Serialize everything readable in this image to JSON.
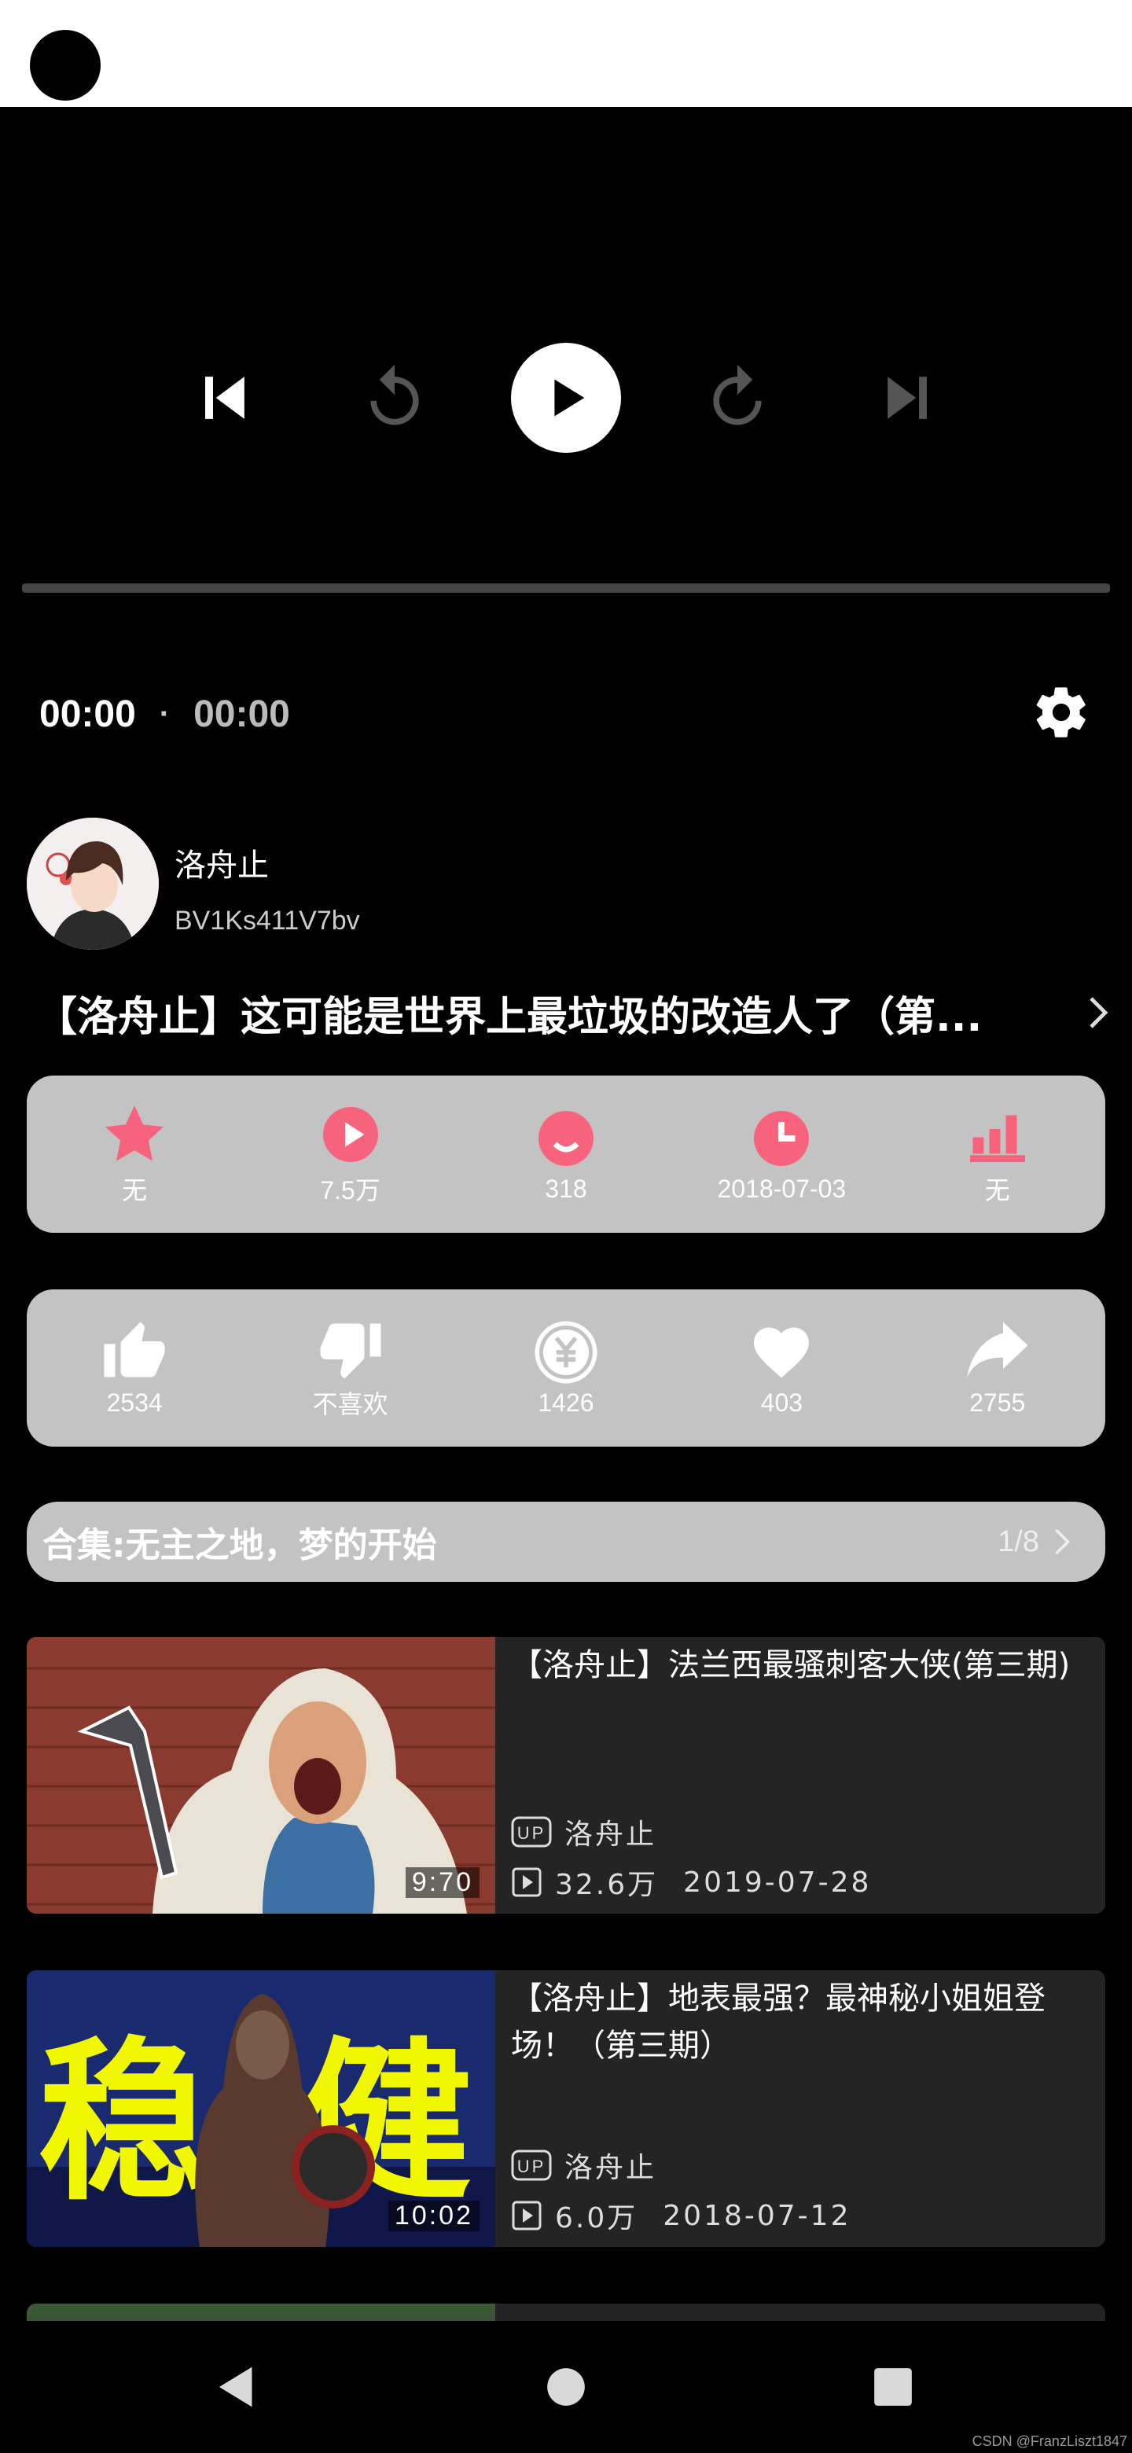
{
  "player": {
    "current_time": "00:00",
    "separator": "·",
    "total_time": "00:00"
  },
  "uploader": {
    "name": "洛舟止",
    "bvid": "BV1Ks411V7bv"
  },
  "video": {
    "title": "【洛舟止】这可能是世界上最垃圾的改造人了（第..."
  },
  "stats": {
    "favorite": "无",
    "plays": "7.5万",
    "danmaku": "318",
    "date": "2018-07-03",
    "rank": "无"
  },
  "actions": {
    "like": "2534",
    "dislike": "不喜欢",
    "coin": "1426",
    "favorite": "403",
    "share": "2755"
  },
  "colors": {
    "accent": "#f7637c",
    "card_bg": "#c3c3c3",
    "item_bg": "#242424"
  },
  "collection": {
    "title": "合集:无主之地，梦的开始",
    "count": "1/8"
  },
  "videos": [
    {
      "title": "【洛舟止】法兰西最骚刺客大侠(第三期)",
      "duration": "9:70",
      "up_badge": "UP",
      "uploader": "洛舟止",
      "views": "32.6万",
      "date": "2019-07-28"
    },
    {
      "title": "【洛舟止】地表最强？最神秘小姐姐登场！（第三期）",
      "duration": "10:02",
      "up_badge": "UP",
      "uploader": "洛舟止",
      "views": "6.0万",
      "date": "2018-07-12",
      "thumb_text_left": "稳",
      "thumb_text_right": "健"
    }
  ],
  "watermark": "CSDN @FranzLiszt1847"
}
